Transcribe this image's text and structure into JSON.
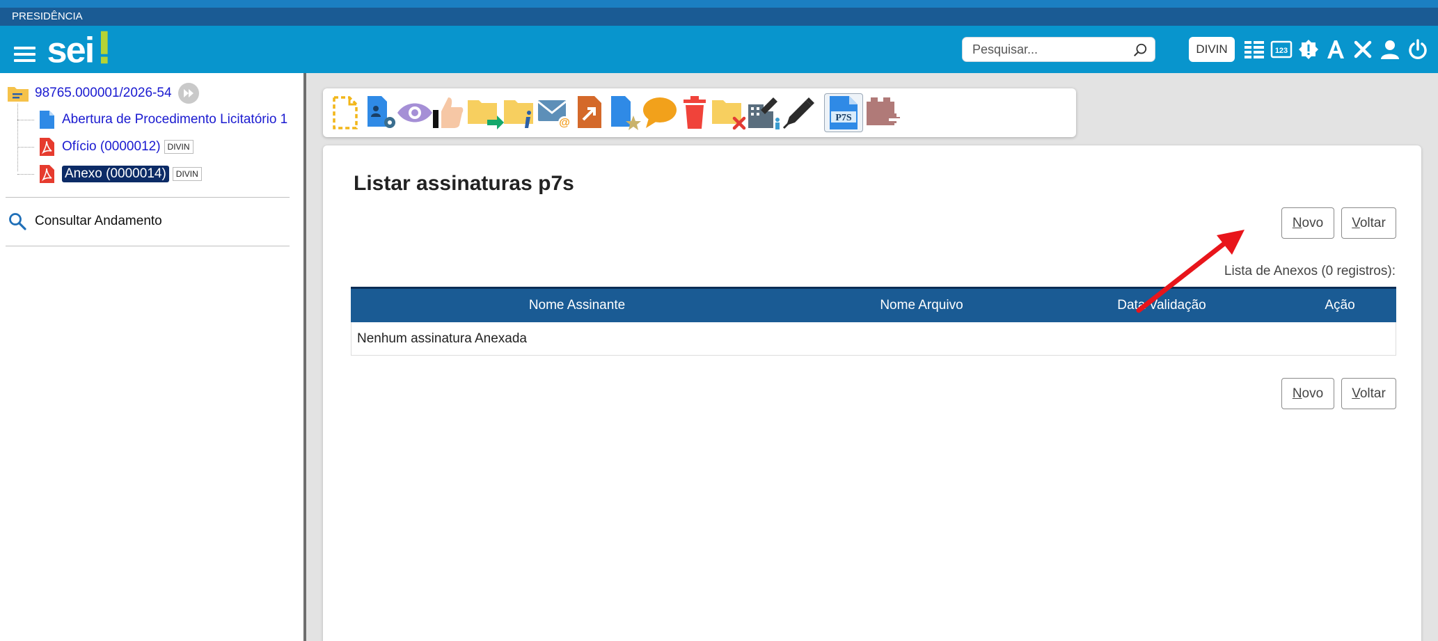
{
  "org": {
    "name": "PRESIDÊNCIA"
  },
  "header": {
    "search_placeholder": "Pesquisar...",
    "unit": "DIVIN"
  },
  "sidebar": {
    "process_number": "98765.000001/2026-54",
    "documents": [
      {
        "label": "Abertura de Procedimento Licitatório 1",
        "tag": ""
      },
      {
        "label": "Ofício (0000012)",
        "tag": "DIVIN"
      },
      {
        "label": "Anexo (0000014)",
        "tag": "DIVIN"
      }
    ],
    "consult_label": "Consultar Andamento"
  },
  "toolbar": {
    "active_icon_text": "P7S"
  },
  "panel": {
    "title": "Listar assinaturas p7s",
    "new_button": {
      "first": "N",
      "rest": "ovo"
    },
    "back_button": {
      "first": "V",
      "rest": "oltar"
    },
    "caption": "Lista de Anexos (0 registros):",
    "columns": [
      "Nome Assinante",
      "Nome Arquivo",
      "Data Validação",
      "Ação"
    ],
    "empty_message": "Nenhum assinatura Anexada"
  },
  "colors": {
    "header_bg": "#0895cd",
    "org_bar_bg": "#1a5b94",
    "table_header_bg": "#1a5b94",
    "selected_doc_bg": "#0c2b66",
    "annotation_arrow": "#e8151b"
  }
}
